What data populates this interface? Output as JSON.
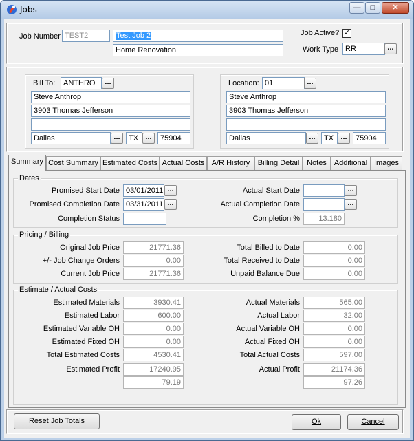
{
  "window": {
    "title": "Jobs",
    "min": "—",
    "max": "□",
    "close": "✕"
  },
  "job": {
    "number_label": "Job Number",
    "number": "TEST2",
    "name": "Test Job 2",
    "description": "Home Renovation",
    "active_label": "Job Active?",
    "active_check": "✓",
    "work_type_label": "Work Type",
    "work_type": "RR"
  },
  "bill_to": {
    "label": "Bill To:",
    "code": "ANTHRO",
    "name": "Steve Anthrop",
    "address1": "3903 Thomas Jefferson",
    "address2": "",
    "city": "Dallas",
    "state": "TX",
    "zip": "75904"
  },
  "location": {
    "label": "Location:",
    "code": "01",
    "name": "Steve Anthrop",
    "address1": "3903 Thomas Jefferson",
    "address2": "",
    "city": "Dallas",
    "state": "TX",
    "zip": "75904"
  },
  "dots": "...",
  "tabs": [
    "Summary",
    "Cost Summary",
    "Estimated Costs",
    "Actual Costs",
    "A/R History",
    "Billing Detail",
    "Notes",
    "Additional",
    "Images"
  ],
  "dates": {
    "legend": "Dates",
    "promised_start_label": "Promised Start Date",
    "promised_start": "03/01/2011",
    "promised_completion_label": "Promised Completion Date",
    "promised_completion": "03/31/2011",
    "completion_status_label": "Completion Status",
    "completion_status": "",
    "actual_start_label": "Actual Start Date",
    "actual_start": "",
    "actual_completion_label": "Actual Completion Date",
    "actual_completion": "",
    "completion_pct_label": "Completion %",
    "completion_pct": "13.180"
  },
  "pricing": {
    "legend": "Pricing / Billing",
    "original_label": "Original Job Price",
    "original": "21771.36",
    "change_orders_label": "+/- Job Change Orders",
    "change_orders": "0.00",
    "current_label": "Current Job Price",
    "current": "21771.36",
    "billed_label": "Total Billed to Date",
    "billed": "0.00",
    "received_label": "Total Received to Date",
    "received": "0.00",
    "unpaid_label": "Unpaid Balance Due",
    "unpaid": "0.00"
  },
  "costs": {
    "legend": "Estimate / Actual Costs",
    "est_materials_label": "Estimated Materials",
    "est_materials": "3930.41",
    "est_labor_label": "Estimated Labor",
    "est_labor": "600.00",
    "est_var_oh_label": "Estimated Variable OH",
    "est_var_oh": "0.00",
    "est_fixed_oh_label": "Estimated Fixed OH",
    "est_fixed_oh": "0.00",
    "total_est_label": "Total Estimated Costs",
    "total_est": "4530.41",
    "est_profit_label": "Estimated Profit",
    "est_profit": "17240.95",
    "est_profit_pct": "79.19",
    "act_materials_label": "Actual Materials",
    "act_materials": "565.00",
    "act_labor_label": "Actual Labor",
    "act_labor": "32.00",
    "act_var_oh_label": "Actual Variable OH",
    "act_var_oh": "0.00",
    "act_fixed_oh_label": "Actual Fixed OH",
    "act_fixed_oh": "0.00",
    "total_act_label": "Total Actual Costs",
    "total_act": "597.00",
    "act_profit_label": "Actual Profit",
    "act_profit": "21174.36",
    "act_profit_pct": "97.26"
  },
  "buttons": {
    "reset": "Reset Job Totals",
    "ok": "Ok",
    "cancel": "Cancel"
  }
}
